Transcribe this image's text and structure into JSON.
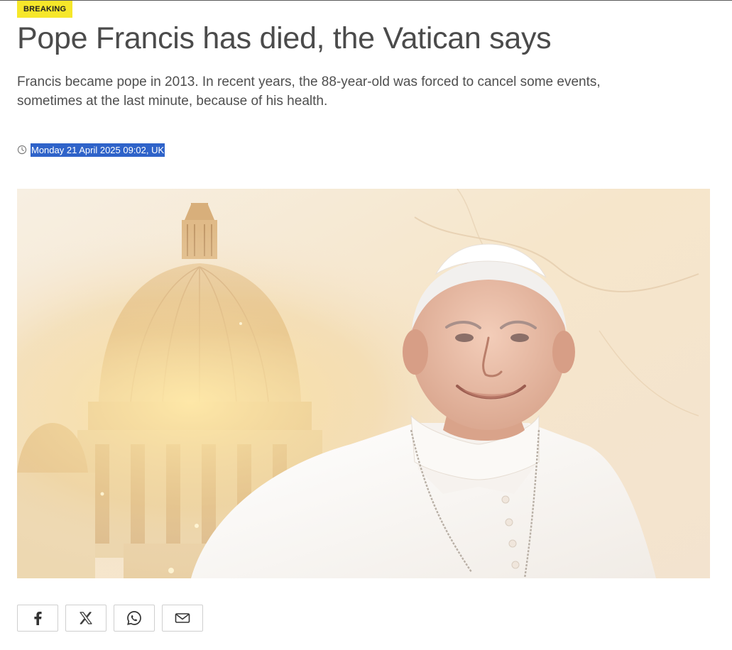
{
  "article": {
    "badge": "BREAKING",
    "headline": "Pope Francis has died, the Vatican says",
    "standfirst": "Francis became pope in 2013. In recent years, the 88-year-old was forced to cancel some events, sometimes at the last minute, because of his health.",
    "timestamp": "Monday 21 April 2025 09:02, UK"
  },
  "colors": {
    "badge_bg": "#f6e72a",
    "selection_highlight": "#2f63c9",
    "text": "#4b4b4b"
  },
  "hero_image": {
    "subject": "portrait of Pope Francis in front of St Peter's Basilica dome"
  },
  "share": [
    {
      "name": "share-facebook-button",
      "icon": "facebook-icon"
    },
    {
      "name": "share-x-button",
      "icon": "x-icon"
    },
    {
      "name": "share-whatsapp-button",
      "icon": "whatsapp-icon"
    },
    {
      "name": "share-email-button",
      "icon": "email-icon"
    }
  ]
}
